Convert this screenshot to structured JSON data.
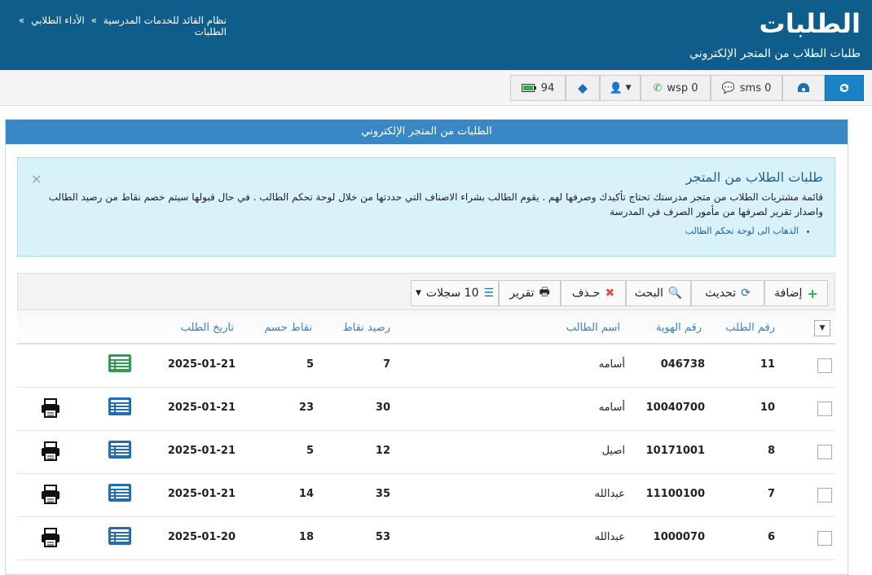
{
  "header": {
    "title": "الطلبات",
    "subtitle": "طلبات الطلاب من المتجر الإلكتروني",
    "breadcrumb": [
      "نظام القائد للخدمات المدرسية",
      "»",
      "الأداء الطلابي",
      "»",
      "الطلبات"
    ]
  },
  "topbar": {
    "battery_value": "94",
    "wsp_label": "wsp 0",
    "sms_label": "sms 0"
  },
  "panel": {
    "heading": "الطلبات من المتجر الإلكتروني"
  },
  "alert": {
    "title": "طلبات الطلاب من المتجر",
    "text": "قائمة مشتريات الطلاب من متجر مدرستك تحتاج تأكيدك وصرفها لهم . يقوم الطالب بشراء الاصناف التي حددتها من خلال لوحة تحكم الطالب . في حال قبولها سيتم خصم نقاط من رصيد الطالب واصدار تقرير لصرفها من مأمور الصرف في المدرسة",
    "link": "الذهاب الى لوحة تحكم الطالب",
    "close": "×"
  },
  "toolbar": {
    "add": "إضافة",
    "refresh": "تحديث",
    "search": "البحث",
    "delete": "حـذف",
    "report": "تقرير",
    "records": "10 سجلات"
  },
  "table": {
    "columns": [
      "رقم الطلب",
      "رقم الهوية",
      "اسم الطالب",
      "رصيد نقاط",
      "نقاط حسم",
      "تاريخ الطلب"
    ],
    "rows": [
      {
        "id": "11",
        "national_id": "046738",
        "name": "أسامه",
        "balance": "7",
        "discount": "5",
        "date": "2025-01-21",
        "list_color": "#2e9e4f",
        "printer": false
      },
      {
        "id": "10",
        "national_id": "10040700",
        "name": "أسامه",
        "balance": "30",
        "discount": "23",
        "date": "2025-01-21",
        "list_color": "#1f6fb2",
        "printer": true
      },
      {
        "id": "8",
        "national_id": "10171001",
        "name": "اصيل",
        "balance": "12",
        "discount": "5",
        "date": "2025-01-21",
        "list_color": "#1f6fb2",
        "printer": true
      },
      {
        "id": "7",
        "national_id": "11100100",
        "name": "عبدالله",
        "balance": "35",
        "discount": "14",
        "date": "2025-01-21",
        "list_color": "#1f6fb2",
        "printer": true
      },
      {
        "id": "6",
        "national_id": "1000070",
        "name": "عبدالله",
        "balance": "53",
        "discount": "18",
        "date": "2025-01-20",
        "list_color": "#1f6fb2",
        "printer": true
      }
    ]
  }
}
